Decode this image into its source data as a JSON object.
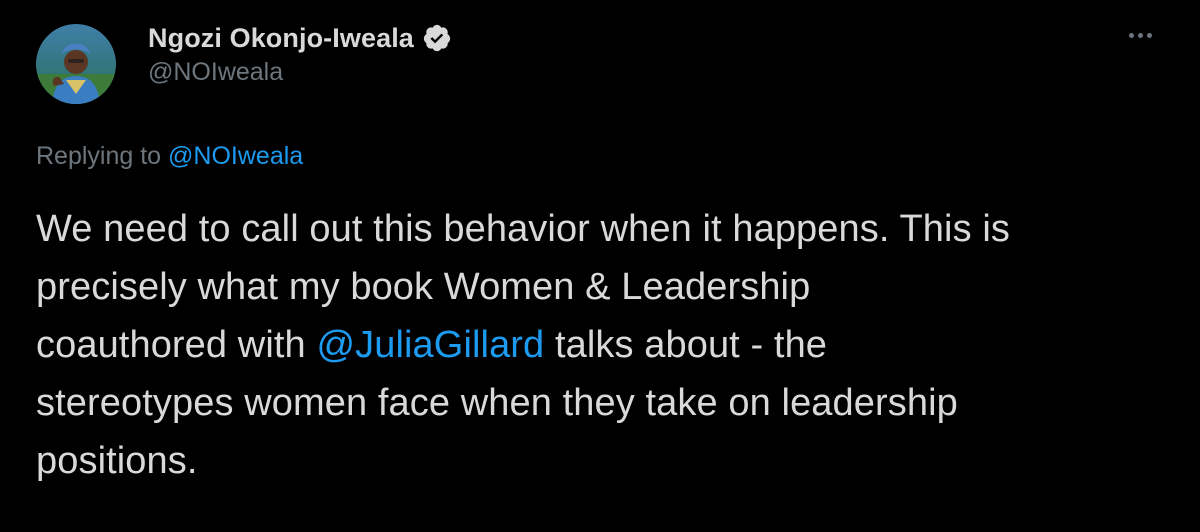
{
  "author": {
    "display_name": "Ngozi Okonjo-Iweala",
    "handle": "@NOIweala",
    "verified": true
  },
  "icons": {
    "verified": "verified-badge-icon",
    "more": "more-options-icon"
  },
  "reply": {
    "prefix": "Replying to ",
    "to_handle": "@NOIweala"
  },
  "tweet": {
    "line1": "We need to call out this behavior when it happens. This is",
    "line2": "precisely what my book Women & Leadership",
    "line3_before": "coauthored with ",
    "line3_mention": "@JuliaGillard",
    "line3_after": " talks about - the",
    "line4": "stereotypes women face when they take on leadership",
    "line5": "positions."
  },
  "colors": {
    "background": "#000000",
    "text": "#d9d9d9",
    "muted": "#6e767d",
    "link": "#1d9bf0"
  }
}
